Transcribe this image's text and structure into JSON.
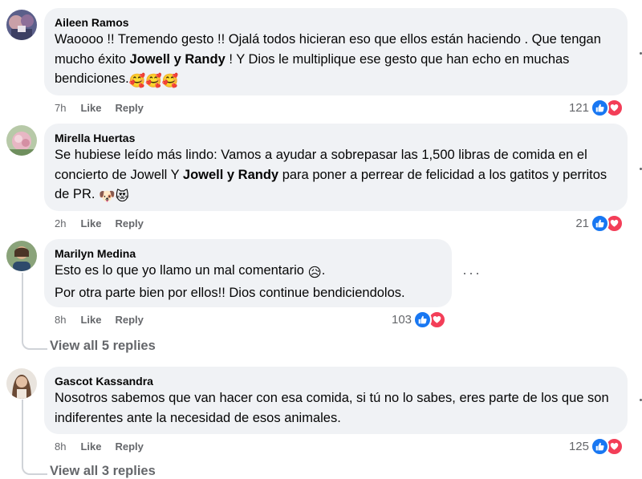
{
  "comments": [
    {
      "author": "Aileen Ramos",
      "text_parts": [
        "Waoooo !! Tremendo gesto !! Ojalá todos hicieran eso que ellos están haciendo . Que tengan mucho éxito ",
        "Jowell y Randy",
        " ! Y Dios le multiplique ese gesto que han echo en muchas bendiciones."
      ],
      "emoji": "🥰🥰🥰",
      "time": "7h",
      "like_label": "Like",
      "reply_label": "Reply",
      "reaction_count": "121"
    },
    {
      "author": "Mirella Huertas",
      "text_parts": [
        "Se hubiese leído más lindo: Vamos a ayudar a sobrepasar las 1,500 libras de comida en el concierto de Jowell Y ",
        "Jowell y Randy",
        " para poner a perrear de felicidad a los gatitos y perritos de PR. "
      ],
      "emoji": "🐶😻",
      "time": "2h",
      "like_label": "Like",
      "reply_label": "Reply",
      "reaction_count": "21"
    },
    {
      "author": "Marilyn Medina",
      "line1": "Esto es lo que yo llamo un mal comentario ",
      "line1_emoji": "😥",
      "line1_end": ".",
      "line2": "Por otra parte bien por ellos!! Dios continue bendiciendolos.",
      "time": "8h",
      "like_label": "Like",
      "reply_label": "Reply",
      "reaction_count": "103",
      "more_label": "···",
      "view_replies": "View all 5 replies"
    },
    {
      "author": "Gascot Kassandra",
      "text": "Nosotros sabemos que van hacer con esa comida, si tú no lo sabes, eres parte de los que son indiferentes ante la necesidad de esos animales.",
      "time": "8h",
      "like_label": "Like",
      "reply_label": "Reply",
      "reaction_count": "125",
      "view_replies": "View all 3 replies"
    }
  ],
  "colors": {
    "like": "#1877f2",
    "love": "#f33e58",
    "bubble": "#f0f2f5",
    "meta": "#65676b"
  },
  "icons": [
    "like-icon",
    "love-icon",
    "more-options-icon"
  ]
}
